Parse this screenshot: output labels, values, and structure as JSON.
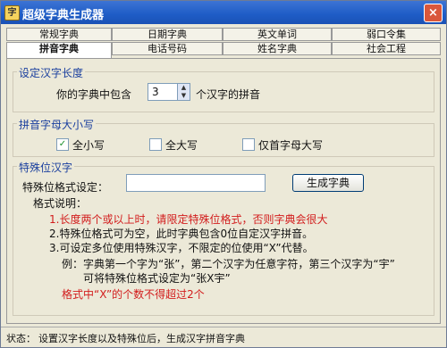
{
  "window": {
    "title": "超级字典生成器",
    "close": "×"
  },
  "tabs_row1": [
    "常规字典",
    "日期字典",
    "英文单词",
    "弱口令集"
  ],
  "tabs_row2": [
    "拼音字典",
    "电话号码",
    "姓名字典",
    "社会工程"
  ],
  "length_group": {
    "legend": "设定汉字长度",
    "prefix": "你的字典中包含",
    "value": "3",
    "suffix": "个汉字的拼音"
  },
  "case_group": {
    "legend": "拼音字母大小写",
    "options": [
      {
        "label": "全小写",
        "checked": true
      },
      {
        "label": "全大写",
        "checked": false
      },
      {
        "label": "仅首字母大写",
        "checked": false
      }
    ]
  },
  "special_group": {
    "legend": "特殊位汉字",
    "format_label": "特殊位格式设定：",
    "format_value": "",
    "generate_button": "生成字典",
    "notes_title": "格式说明：",
    "notes": [
      "1.长度两个或以上时，请限定特殊位格式，否则字典会很大",
      "2.特殊位格式可为空，此时字典包含0位自定汉字拼音。",
      "3.可设定多位使用特殊汉字，不限定的位使用“X”代替。",
      "例：字典第一个字为“张”，第二个汉字为任意字符，第三个汉字为“宇”",
      "可将特殊位格式设定为“张X宇”",
      "格式中“X”的个数不得超过2个"
    ]
  },
  "status": {
    "label": "状态：",
    "text": "设置汉字长度以及特殊位后，生成汉字拼音字典"
  }
}
